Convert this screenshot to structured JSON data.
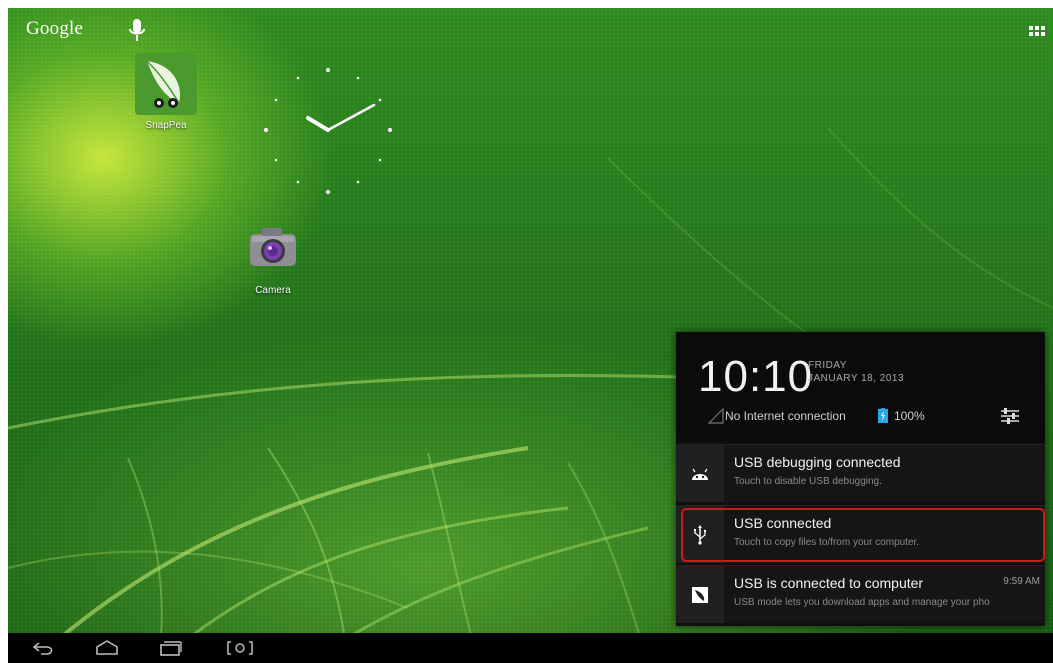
{
  "home": {
    "search_label": "Google",
    "apps": [
      {
        "label": "SnapPea"
      },
      {
        "label": "Camera"
      }
    ]
  },
  "notifications_panel": {
    "time": "10:10",
    "day": "FRIDAY",
    "date": "JANUARY 18, 2013",
    "network_status": "No Internet connection",
    "battery": "100%",
    "items": [
      {
        "title": "USB debugging connected",
        "subtitle": "Touch to disable USB debugging.",
        "icon": "android-icon",
        "time": ""
      },
      {
        "title": "USB connected",
        "subtitle": "Touch to copy files to/from your computer.",
        "icon": "usb-icon",
        "time": ""
      },
      {
        "title": "USB is connected to computer",
        "subtitle": "USB mode lets you download apps and manage your pho",
        "icon": "snappea-icon",
        "time": "9:59 AM"
      }
    ]
  },
  "colors": {
    "highlight": "#d01818",
    "panel_bg": "#0f0f10",
    "battery_accent": "#2aa7e8"
  }
}
